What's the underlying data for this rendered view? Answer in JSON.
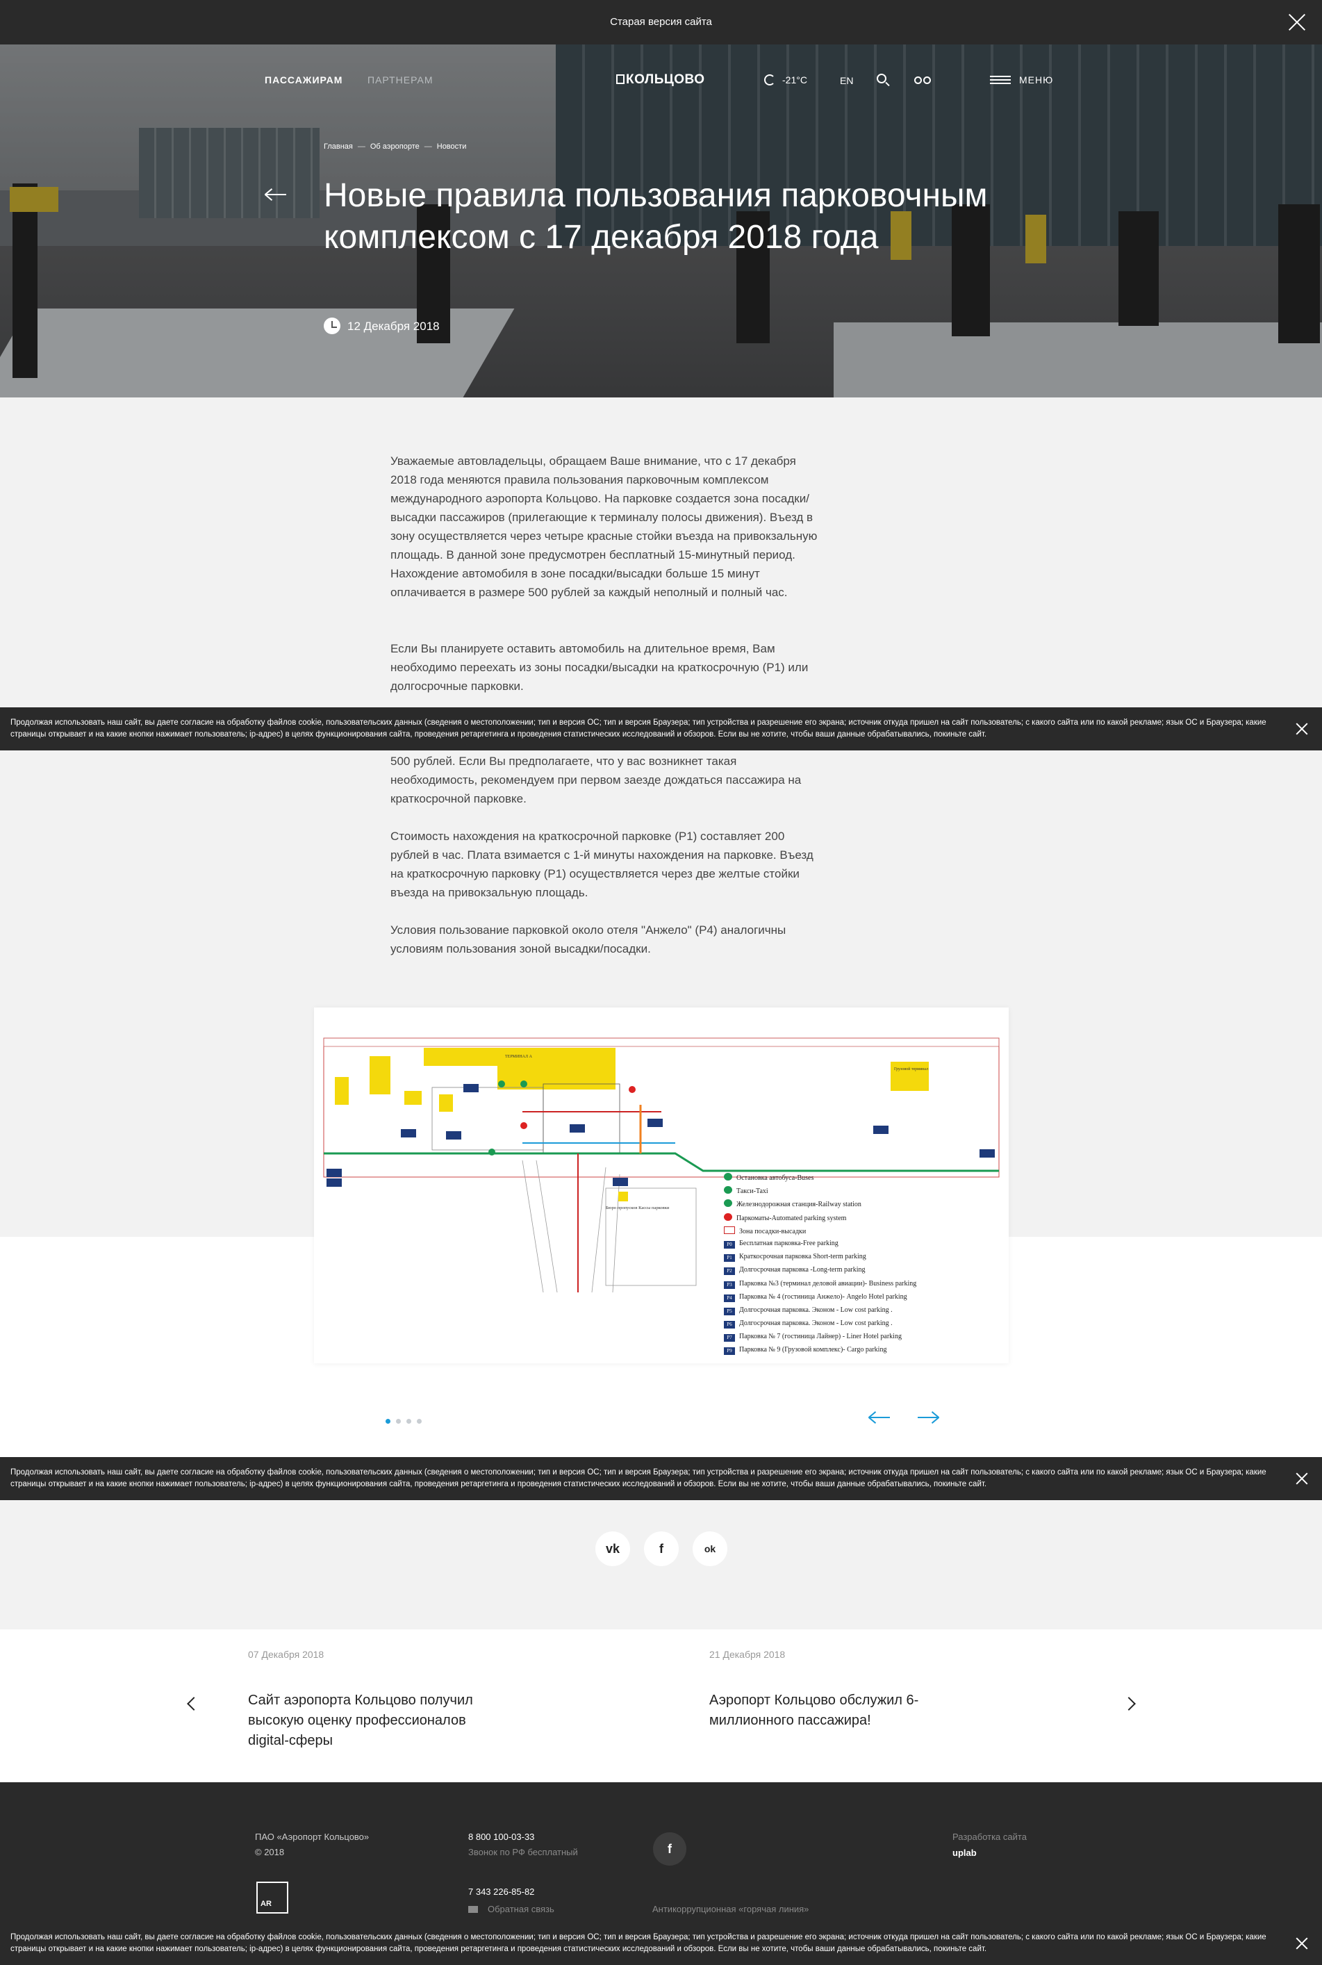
{
  "topbar": {
    "old_version": "Старая версия сайта"
  },
  "header": {
    "nav_passengers": "ПАССАЖИРАМ",
    "nav_partners": "ПАРТНЕРАМ",
    "logo": "КОЛЬЦОВО",
    "weather": "-21°C",
    "lang": "EN",
    "menu": "МЕНЮ"
  },
  "breadcrumb": [
    "Главная",
    "Об аэропорте",
    "Новости"
  ],
  "article": {
    "title": "Новые правила пользования парковочным комплексом с 17 декабря 2018 года",
    "date": "12 Декабря 2018",
    "paragraphs": [
      "Уважаемые автовладельцы, обращаем Ваше внимание, что с 17 декабря 2018 года меняются правила пользования парковочным комплексом международного аэропорта Кольцово. На парковке создается зона посадки/высадки пассажиров (прилегающие к терминалу полосы движения). Въезд в зону осуществляется через четыре красные стойки въезда на привокзальную площадь. В данной зоне  предусмотрен бесплатный 15-минутный период. Нахождение автомобиля в зоне посадки/высадки больше 15 минут оплачивается в размере 500 рублей за каждый неполный и полный час.",
      "Если Вы планируете оставить автомобиль на длительное  время, Вам необходимо переехать из зоны посадки/высадки на краткосрочную (P1) или долгосрочные парковки.",
      "500 рублей. Если Вы предполагаете, что у вас возникнет такая необходимость, рекомендуем при первом заезде дождаться пассажира на краткосрочной парковке.",
      "Стоимость нахождения на краткосрочной парковке (P1) составляет 200 рублей в час. Плата взимается с 1-й минуты нахождения на парковке. Въезд на краткосрочную парковку (P1) осуществляется через две желтые стойки въезда на привокзальную площадь.",
      "Условия пользование парковкой около отеля \"Анжело\" (P4) аналогичны условиям пользования зоной высадки/посадки."
    ]
  },
  "cookie_text": "Продолжая использовать наш сайт, вы даете согласие на обработку файлов cookie, пользовательских данных (сведения о местоположении; тип и версия ОС; тип и версия Браузера; тип устройства и разрешение его экрана; источник откуда пришел на сайт пользователь; с какого сайта или по какой рекламе; язык ОС и Браузера; какие страницы открывает и на какие кнопки нажимает пользователь; ip-адрес) в целях функционирования сайта, проведения ретаргетинга и проведения статистических исследований и обзоров. Если вы не хотите, чтобы ваши данные обрабатывались, покиньте сайт.",
  "map": {
    "terminal_label": "ТЕРМИНАЛ А",
    "cargo_label": "Грузовой терминал",
    "office_label": "Бюро пропусков\nКассы парковки",
    "legend": [
      "Остановка автобуса-Buses",
      "Такси-Taxi",
      "Железнодорожная станция-Railway station",
      "Паркоматы-Automated parking system",
      "Зона посадки-высадки",
      "Бесплатная парковка-Free parking",
      "Краткосрочная парковка Short-term parking",
      "Долгосрочная парковка -Long-term parking",
      "Парковка №3 (терминал деловой авиации)- Business parking",
      "Парковка № 4 (гостиница Анжело)- Angelo Hotel parking",
      "Долгосрочная парковка. Эконом - Low cost parking .",
      "Долгосрочная парковка. Эконом - Low cost parking .",
      "Парковка № 7 (гостиница Лайнер) - Liner Hotel parking",
      "Парковка № 9 (Грузовой комплекс)- Cargo parking"
    ],
    "legend_codes": [
      "",
      "",
      "",
      "",
      "",
      "P0",
      "P1",
      "P2",
      "P3",
      "P4",
      "P5",
      "P6",
      "P7",
      "P9"
    ]
  },
  "social": {
    "vk": "vk",
    "fb": "f",
    "ok": "ok"
  },
  "related": [
    {
      "date": "07 Декабря 2018",
      "title": "Сайт аэропорта Кольцово получил высокую оценку профессионалов digital-сферы"
    },
    {
      "date": "21 Декабря 2018",
      "title": "Аэропорт Кольцово обслужил 6-миллионного пассажира!"
    }
  ],
  "footer": {
    "company": "ПАО «Аэропорт Кольцово»",
    "year": "© 2018",
    "phone1": "8 800 100-03-33",
    "phone1_note": "Звонок по РФ бесплатный",
    "phone2": "7 343 226-85-82",
    "feedback": "Обратная связь",
    "anticorruption": "Антикоррупционная «горячая линия»",
    "dev_label": "Разработка сайта",
    "dev_name": "uplab",
    "ar_logo": "AR"
  },
  "colors": {
    "accent": "#1b9bd8",
    "dark": "#2a2a2a"
  }
}
